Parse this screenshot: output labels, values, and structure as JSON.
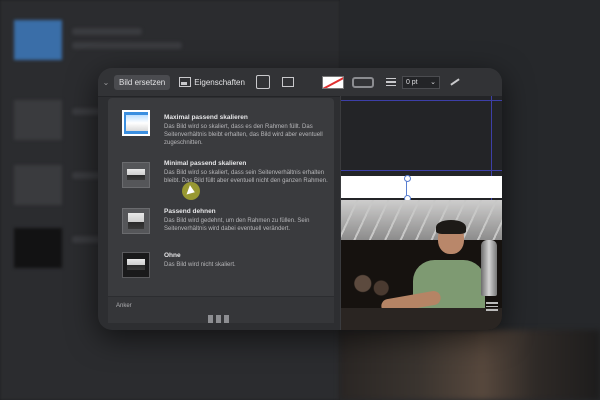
{
  "toolbar": {
    "replace_image_label": "Bild ersetzen",
    "properties_label": "Eigenschaften",
    "stroke_width_value": "0 pt"
  },
  "scale_menu": {
    "items": [
      {
        "title": "Maximal passend skalieren",
        "description": "Das Bild wird so skaliert, dass es den Rahmen füllt. Das Seitenverhältnis bleibt erhalten, das Bild wird aber eventuell zugeschnitten.",
        "selected": true
      },
      {
        "title": "Minimal passend skalieren",
        "description": "Das Bild wird so skaliert, dass sein Seitenverhältnis erhalten bleibt. Das Bild füllt aber eventuell nicht den ganzen Rahmen.",
        "selected": false
      },
      {
        "title": "Passend dehnen",
        "description": "Das Bild wird gedehnt, um den Rahmen zu füllen. Sein Seitenverhältnis wird dabei eventuell verändert.",
        "selected": false
      },
      {
        "title": "Ohne",
        "description": "Das Bild wird nicht skaliert.",
        "selected": false
      }
    ],
    "footer_label": "Anker"
  },
  "colors": {
    "accent_blue": "#3b8fe0",
    "guide_line": "#3d3fa8",
    "none_swatch_slash": "#e03030",
    "cursor_highlight": "#e6e628"
  },
  "icons": {
    "chevron": "chevron-down-icon",
    "properties": "image-properties-icon",
    "align": "lines-icon",
    "pen": "pen-icon"
  }
}
